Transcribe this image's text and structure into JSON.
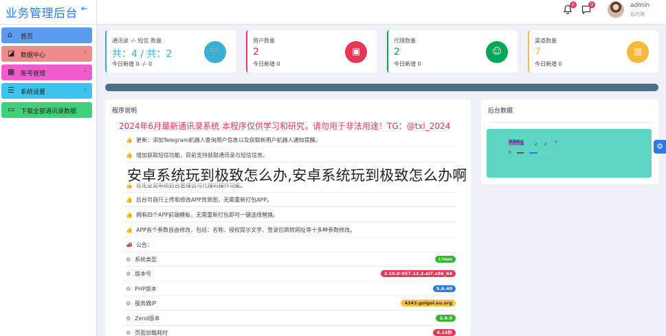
{
  "app": {
    "title": "业务管理后台",
    "collapse_icon": "collapse-icon"
  },
  "header": {
    "bell_badge": "0",
    "message_badge": "0",
    "user_name": "admin",
    "user_role": "后代理"
  },
  "sidebar": {
    "items": [
      {
        "label": "首页",
        "icon": "home-icon",
        "color": "#5c9cf0"
      },
      {
        "label": "数据中心",
        "icon": "data-icon",
        "color": "#ef8a8a",
        "arrow": "‹"
      },
      {
        "label": "账号管理",
        "icon": "grid-icon",
        "color": "#f05ccc",
        "arrow": "‹"
      },
      {
        "label": "系统设置",
        "icon": "menu-icon",
        "color": "#3ec3ec",
        "arrow": "‹"
      },
      {
        "label": "下载全部通讯录数据",
        "icon": "folder-icon",
        "color": "#3fd07a"
      }
    ]
  },
  "stats": [
    {
      "title": "通讯录 -/- 短信 数量",
      "value": "共：4 / 共：2",
      "sub": "今日新增 0 -/- 0",
      "color": "#39afd1",
      "icon": "cart-icon"
    },
    {
      "title": "用户数量",
      "value": "2",
      "sub": "今日新增 0",
      "color": "#e63757",
      "icon": "wallet-icon"
    },
    {
      "title": "代理数量",
      "value": "2",
      "sub": "今日新增 0",
      "color": "#00a65a",
      "icon": "users-icon"
    },
    {
      "title": "渠道数量",
      "value": "7",
      "sub": "今日新增 0",
      "color": "#f6b93b",
      "icon": "chart-icon"
    }
  ],
  "program": {
    "title": "程序说明",
    "heading": "2024年6月最新通讯录系统 本程序仅供学习和研究，请勿用于非法用途！TG：@txl_2024",
    "notes": [
      "更新：添加Telegram机器人查询用户信息以及获取新用户机器人通知提醒。",
      "增加获取短信功能，目前支持获取通讯录与短信信息。",
      "优化业务系统后台管理员与代理的操作功能。",
      "后台可自行上传和修改APP背景图，无需重新打包APP。",
      "拥有四个APP前端模板，无需重新打包即可一键选择替换。",
      "APP各个参数自由修改，包括：名称、授权提示文字、登录后跳转网址等十多种参数修改。"
    ],
    "notice_label": "公告：",
    "rows": [
      {
        "label": "系统类型",
        "value": "Linux",
        "color": "#2eb82e"
      },
      {
        "label": "版本号",
        "value": "3.10.0-957.12.2.el7.x86_64",
        "color": "#e63757"
      },
      {
        "label": "PHP版本",
        "value": "5.6.40",
        "color": "#2c7be5"
      },
      {
        "label": "服务器IP",
        "value": "4343.golgol.eu.org",
        "color": "#f6c343"
      },
      {
        "label": "Zend版本",
        "value": "2.6.0",
        "color": "#2eb82e"
      },
      {
        "label": "页面加载耗时",
        "value": "0.15秒",
        "color": "#e63757"
      }
    ]
  },
  "backend": {
    "title": "后台数据",
    "legend": "数量统计",
    "mini_labels": [
      "4",
      "2",
      "2",
      "7"
    ],
    "mini_zero": "0"
  },
  "watermark": "安卓系统玩到极致怎么办,安卓系统玩到极致怎么办啊"
}
